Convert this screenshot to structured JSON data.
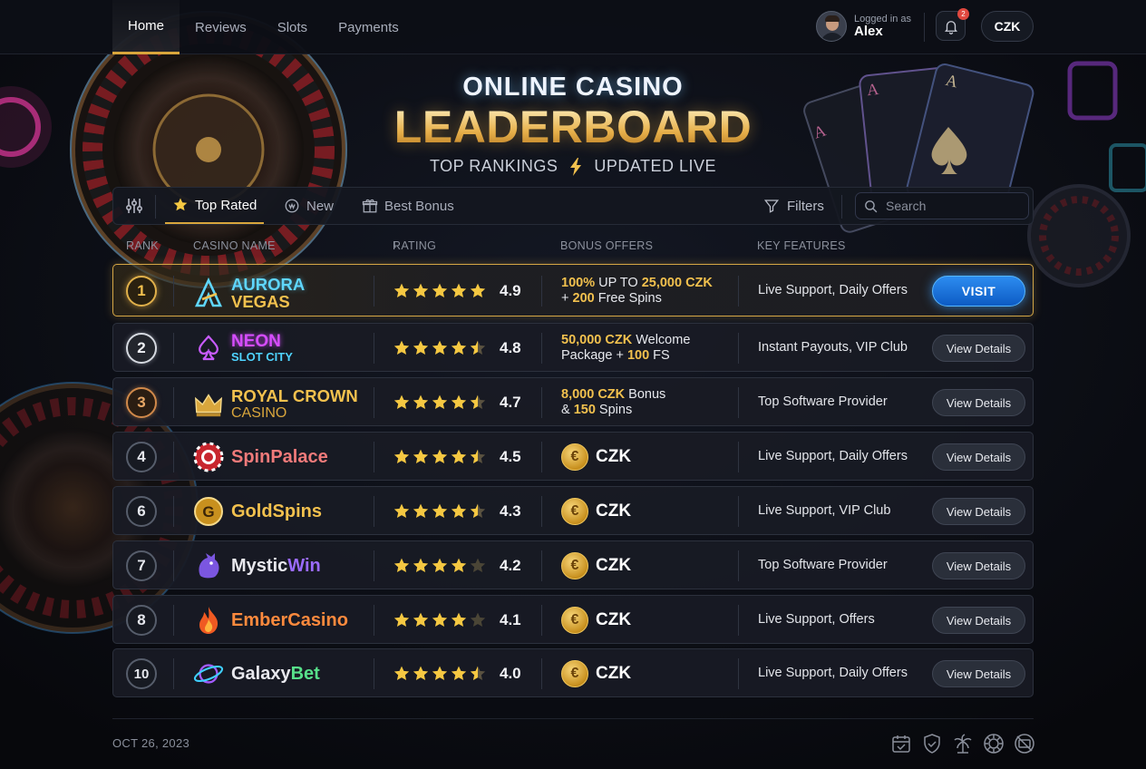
{
  "nav": {
    "items": [
      {
        "label": "Home",
        "active": true
      },
      {
        "label": "Reviews",
        "active": false
      },
      {
        "label": "Slots",
        "active": false
      },
      {
        "label": "Payments",
        "active": false
      }
    ]
  },
  "user": {
    "status_label": "Logged in as",
    "name": "Alex"
  },
  "notifications": {
    "badge": "2"
  },
  "currency": "CZK",
  "hero": {
    "line1": "ONLINE CASINO",
    "line2": "LEADERBOARD",
    "line3_left": "TOP RANKINGS",
    "line3_right": "UPDATED LIVE"
  },
  "filterbar": {
    "tabs": [
      {
        "label": "Top Rated",
        "icon": "star-icon",
        "active": true
      },
      {
        "label": "New",
        "icon": "new-badge-icon",
        "active": false
      },
      {
        "label": "Best Bonus",
        "icon": "gift-icon",
        "active": false
      }
    ],
    "filters_label": "Filters",
    "search_placeholder": "Search"
  },
  "columns": {
    "rank": "RANK",
    "name": "CASINO NAME",
    "rating": "RATING",
    "bonus": "BONUS OFFERS",
    "features": "KEY FEATURES"
  },
  "casinos": [
    {
      "rank": "1",
      "name_l1": "AURORA",
      "name_l2": "VEGAS",
      "rating": "4.9",
      "stars": 5,
      "bonus_parts": [
        [
          "100%",
          true
        ],
        [
          " UP TO ",
          false
        ],
        [
          "25,000 CZK",
          true
        ]
      ],
      "bonus_parts2": [
        [
          "+ ",
          false
        ],
        [
          "200",
          true
        ],
        [
          " Free Spins",
          false
        ]
      ],
      "features": "Live Support, Daily Offers",
      "action": "VISIT",
      "color1": "#5fd6ff",
      "color2": "#f2c14e"
    },
    {
      "rank": "2",
      "name_l1": "NEON",
      "name_l2": "SLOT CITY",
      "rating": "4.8",
      "stars": 4.5,
      "bonus_parts": [
        [
          "50,000 CZK",
          true
        ],
        [
          " Welcome",
          false
        ]
      ],
      "bonus_parts2": [
        [
          "Package + ",
          false
        ],
        [
          "100",
          true
        ],
        [
          " FS",
          false
        ]
      ],
      "features": "Instant Payouts, VIP Club",
      "action": "View Details",
      "color1": "#d64dff",
      "color2": "#4fd3ff"
    },
    {
      "rank": "3",
      "name_l1": "ROYAL CROWN",
      "name_l2": "CASINO",
      "rating": "4.7",
      "stars": 4.5,
      "bonus_parts": [
        [
          "8,000 CZK",
          true
        ],
        [
          " Bonus",
          false
        ]
      ],
      "bonus_parts2": [
        [
          "& ",
          false
        ],
        [
          "150",
          true
        ],
        [
          " Spins",
          false
        ]
      ],
      "features": "Top Software Provider",
      "action": "View Details",
      "color1": "#f2c14e",
      "color2": "#d9a63c"
    },
    {
      "rank": "4",
      "name": "SpinPalace",
      "rating": "4.5",
      "stars": 4.5,
      "bonus": "CZK",
      "features": "Live Support, Daily Offers",
      "action": "View Details",
      "color1": "#f07a7a"
    },
    {
      "rank": "6",
      "name": "GoldSpins",
      "rating": "4.3",
      "stars": 4.5,
      "bonus": "CZK",
      "features": "Live Support, VIP Club",
      "action": "View Details",
      "color1": "#f2c14e"
    },
    {
      "rank": "7",
      "name_a": "Mystic",
      "name_b": "Win",
      "rating": "4.2",
      "stars": 4,
      "bonus": "CZK",
      "features": "Top Software Provider",
      "action": "View Details",
      "color1": "#e8e8ee",
      "color2": "#9a6bff"
    },
    {
      "rank": "8",
      "name": "EmberCasino",
      "rating": "4.1",
      "stars": 4,
      "bonus": "CZK",
      "features": "Live Support, Offers",
      "action": "View Details",
      "color1": "#ff8a3d"
    },
    {
      "rank": "10",
      "name_a": "Galaxy",
      "name_b": "Bet",
      "rating": "4.0",
      "stars": 4.5,
      "bonus": "CZK",
      "features": "Live Support, Daily Offers",
      "action": "View Details",
      "color1": "#e8e8ee",
      "color2": "#57e08a"
    }
  ],
  "footer": {
    "date": "OCT 26, 2023",
    "icons": [
      "calendar-check-icon",
      "shield-check-icon",
      "palm-tree-icon",
      "chip-icon",
      "no-card-icon"
    ]
  },
  "colors": {
    "accent_gold": "#d9a63c",
    "visit_blue": "#1a74dc",
    "star": "#f5c842"
  }
}
